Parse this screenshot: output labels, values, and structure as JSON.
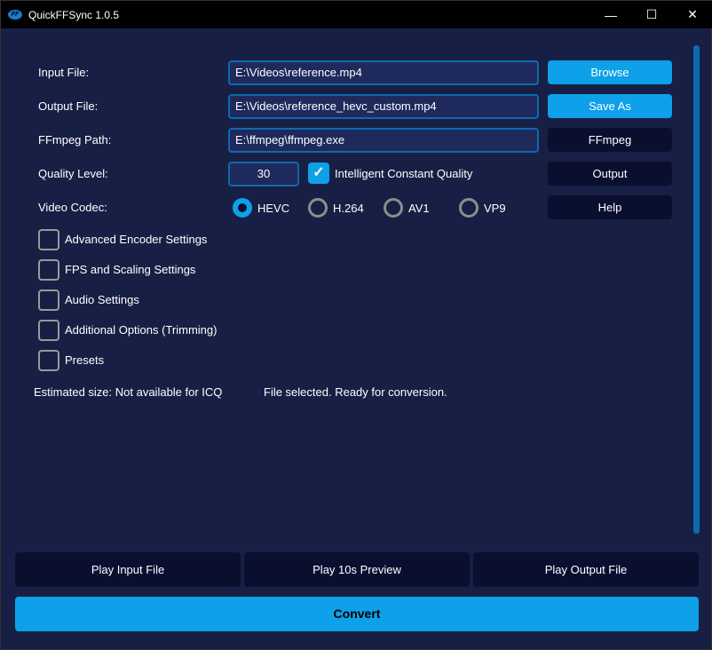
{
  "window": {
    "title": "QuickFFSync 1.0.5",
    "logo_text": "FF"
  },
  "fields": {
    "input_label": "Input File:",
    "input_value": "E:\\Videos\\reference.mp4",
    "output_label": "Output File:",
    "output_value": "E:\\Videos\\reference_hevc_custom.mp4",
    "ffmpeg_label": "FFmpeg Path:",
    "ffmpeg_value": "E:\\ffmpeg\\ffmpeg.exe",
    "quality_label": "Quality Level:",
    "quality_value": "30",
    "icq_label": "Intelligent Constant Quality",
    "icq_checked": true,
    "codec_label": "Video Codec:"
  },
  "buttons": {
    "browse": "Browse",
    "save_as": "Save As",
    "ffmpeg": "FFmpeg",
    "output": "Output",
    "help": "Help",
    "play_input": "Play Input File",
    "play_preview": "Play 10s Preview",
    "play_output": "Play Output File",
    "convert": "Convert"
  },
  "codecs": [
    {
      "label": "HEVC",
      "selected": true
    },
    {
      "label": "H.264",
      "selected": false
    },
    {
      "label": "AV1",
      "selected": false
    },
    {
      "label": "VP9",
      "selected": false
    }
  ],
  "sections": [
    "Advanced Encoder Settings",
    "FPS and Scaling Settings",
    "Audio Settings",
    "Additional Options (Trimming)",
    "Presets"
  ],
  "status": {
    "estimated_size": "Estimated size: Not available for ICQ",
    "message": "File selected. Ready for conversion."
  }
}
